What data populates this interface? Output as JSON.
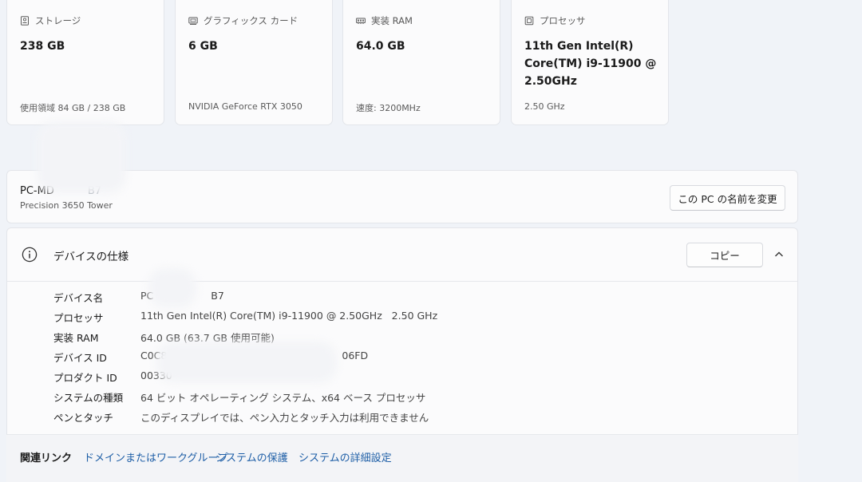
{
  "cards": [
    {
      "icon": "storage-icon",
      "label": "ストレージ",
      "value": "238 GB",
      "sub": "使用領域 84 GB / 238 GB"
    },
    {
      "icon": "graphics-card-icon",
      "label": "グラフィックス カード",
      "value": "6 GB",
      "sub": "NVIDIA GeForce RTX 3050"
    },
    {
      "icon": "ram-icon",
      "label": "実装 RAM",
      "value": "64.0 GB",
      "sub": "速度: 3200MHz"
    },
    {
      "icon": "processor-icon",
      "label": "プロセッサ",
      "value": "11th Gen Intel(R) Core(TM) i9-11900 @ 2.50GHz",
      "sub": "2.50 GHz"
    }
  ],
  "pc": {
    "name": "PC-MD",
    "name_tail": "B7",
    "model": "Precision 3650 Tower",
    "rename_button": "この PC の名前を変更"
  },
  "specs": {
    "title": "デバイスの仕様",
    "copy_button": "コピー",
    "rows": [
      {
        "label": "デバイス名",
        "value": "PC",
        "value_tail": "B7"
      },
      {
        "label": "プロセッサ",
        "value": "11th Gen Intel(R) Core(TM) i9-11900 @ 2.50GHz   2.50 GHz"
      },
      {
        "label": "実装 RAM",
        "value": "64.0 GB (63.7 GB 使用可能)"
      },
      {
        "label": "デバイス ID",
        "value": "C0C8",
        "value_tail": "06FD"
      },
      {
        "label": "プロダクト ID",
        "value": "00330"
      },
      {
        "label": "システムの種類",
        "value": "64 ビット オペレーティング システム、x64 ベース プロセッサ"
      },
      {
        "label": "ペンとタッチ",
        "value": "このディスプレイでは、ペン入力とタッチ入力は利用できません"
      }
    ]
  },
  "related": {
    "title": "関連リンク",
    "links": [
      "ドメインまたはワークグループ",
      "システムの保護",
      "システムの詳細設定"
    ]
  }
}
